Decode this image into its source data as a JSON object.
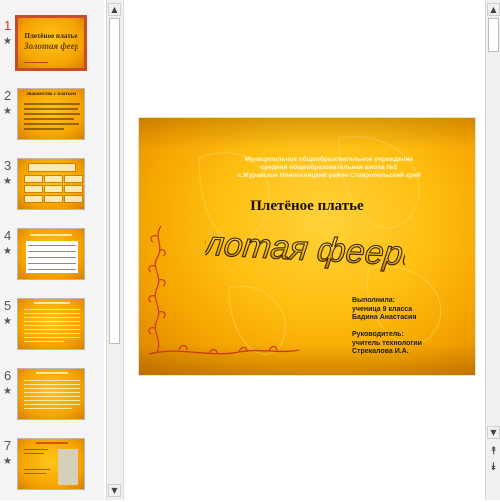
{
  "thumbnails": [
    {
      "number": "1",
      "title": "Плетёное платье",
      "subtitle": "Золотая феерия",
      "selected": true
    },
    {
      "number": "2",
      "title": "Знакомство с платьем",
      "selected": false
    },
    {
      "number": "3",
      "title": "",
      "selected": false
    },
    {
      "number": "4",
      "title": "",
      "selected": false
    },
    {
      "number": "5",
      "title": "",
      "selected": false
    },
    {
      "number": "6",
      "title": "",
      "selected": false
    },
    {
      "number": "7",
      "title": "",
      "selected": false
    }
  ],
  "thumb_star": "★",
  "scroll": {
    "up": "▲",
    "down": "▼",
    "prev_slide": "⯭",
    "next_slide": "⯯"
  },
  "slide": {
    "institution_line1": "Муниципальное общеобразовательное учреждение",
    "institution_line2": "средняя общеобразовательная школа №5",
    "institution_line3": "с.Журавское Новоселицкий район Ставропольский край",
    "title": "Плетёное платье",
    "art_title": "Золотая феерия",
    "performed_label": "Выполнила:",
    "performed_line1": "ученица 9 класса",
    "performed_line2": "Бадина Анастасия",
    "supervisor_label": "Руководитель:",
    "supervisor_line1": "учитель технологии",
    "supervisor_line2": "Стрекалова И.А."
  },
  "colors": {
    "slide_gold": "#ffbf12",
    "selected_border": "#c84b2a",
    "ornament_red": "#d13b1a"
  }
}
